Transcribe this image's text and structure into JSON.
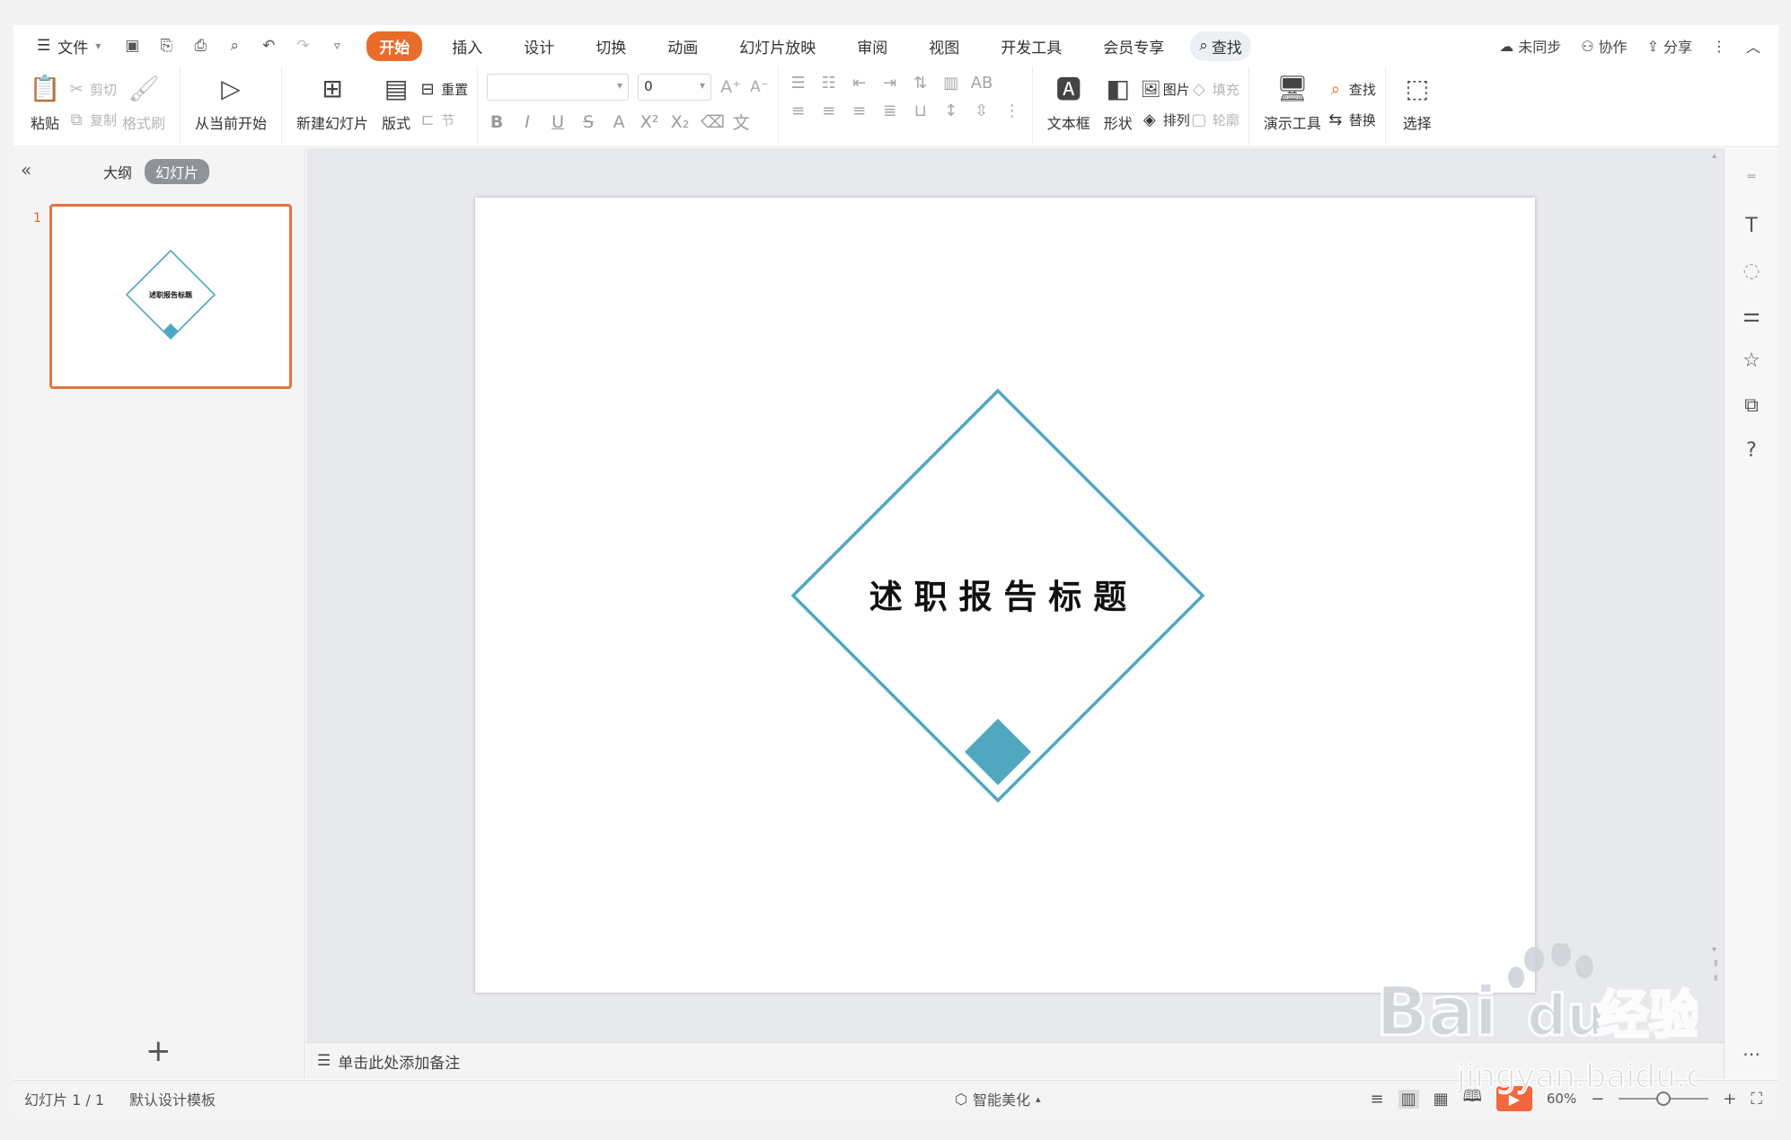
{
  "menubar": {
    "file_label": "文件",
    "tabs": [
      "开始",
      "插入",
      "设计",
      "切换",
      "动画",
      "幻灯片放映",
      "审阅",
      "视图",
      "开发工具",
      "会员专享"
    ],
    "active_tab": "开始",
    "search_label": "查找",
    "right": {
      "sync_label": "未同步",
      "collab_label": "协作",
      "share_label": "分享"
    }
  },
  "ribbon": {
    "paste": "粘贴",
    "cut": "剪切",
    "copy": "复制",
    "format_painter": "格式刷",
    "play_from_current": "从当前开始",
    "new_slide": "新建幻灯片",
    "layout": "版式",
    "reset": "重置",
    "section": "节",
    "font_size_value": "0",
    "textbox": "文本框",
    "shape": "形状",
    "picture": "图片",
    "fill": "填充",
    "arrange": "排列",
    "outline": "轮廓",
    "presentation_tools": "演示工具",
    "find": "查找",
    "replace": "替换",
    "select": "选择"
  },
  "left_panel": {
    "tab_outline": "大纲",
    "tab_slides": "幻灯片",
    "slide_number": "1",
    "thumb_title": "述职报告标题"
  },
  "slide": {
    "title": "述 职 报 告 标 题",
    "accent_color": "#4fa8bf"
  },
  "notes": {
    "placeholder": "单击此处添加备注"
  },
  "status": {
    "slide_indicator": "幻灯片 1 / 1",
    "template": "默认设计模板",
    "smart_beautify": "智能美化",
    "zoom": "60%"
  },
  "watermark": {
    "brand": "Bai",
    "brand2": "du",
    "cn": "经验",
    "url": "jingyan.baidu.com"
  }
}
